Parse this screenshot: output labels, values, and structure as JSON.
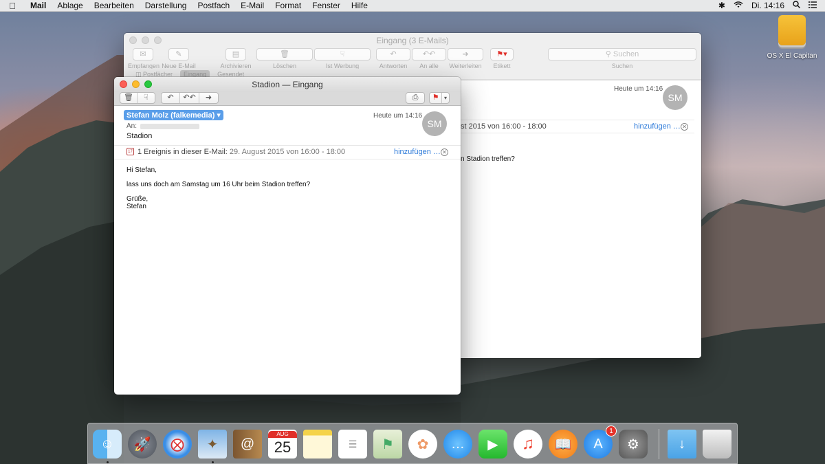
{
  "menubar": {
    "app_name": "Mail",
    "items": [
      "Ablage",
      "Bearbeiten",
      "Darstellung",
      "Postfach",
      "E-Mail",
      "Format",
      "Fenster",
      "Hilfe"
    ],
    "clock": "Di. 14:16"
  },
  "desktop": {
    "drive_label": "OS X El Capitan"
  },
  "back_window": {
    "title": "Eingang (3 E-Mails)",
    "toolbar": {
      "empfangen": "Empfangen",
      "neue_email": "Neue E-Mail",
      "archivieren": "Archivieren",
      "loeschen": "Löschen",
      "werbung": "Ist Werbung",
      "antworten": "Antworten",
      "an_alle": "An alle",
      "weiterleiten": "Weiterleiten",
      "etikett": "Etikett",
      "search_placeholder": "Suchen",
      "search_label": "Suchen"
    },
    "tabs": [
      "Postfächer",
      "Eingang",
      "Gesendet"
    ],
    "preview": {
      "date": "Heute um 14:16",
      "avatar": "SM",
      "event_fragment": "st 2015 von 16:00 - 18:00",
      "event_link": "hinzufügen …",
      "body_fragment": "n Stadion treffen?"
    }
  },
  "front_window": {
    "title": "Stadion — Eingang",
    "sender": "Stefan Molz (falkemedia)",
    "to_label": "An:",
    "subject": "Stadion",
    "date": "Heute um 14:16",
    "avatar": "SM",
    "event_text": "1 Ereignis in dieser E-Mail:",
    "event_detail": "29. August 2015 von 16:00 - 18:00",
    "event_link": "hinzufügen …",
    "body": {
      "greeting": "Hi Stefan,",
      "line1": "lass uns doch am Samstag um 16 Uhr beim Stadion treffen?",
      "closing": "Grüße,\nStefan"
    }
  },
  "dock": {
    "calendar_month": "AUG",
    "calendar_day": "25",
    "appstore_badge": "1"
  },
  "colors": {
    "accent": "#5a9ee9",
    "link": "#2d7ad9",
    "close": "#fc5f57",
    "minimize": "#fdbc2e",
    "zoom": "#28c840",
    "flag": "#e0302a"
  }
}
